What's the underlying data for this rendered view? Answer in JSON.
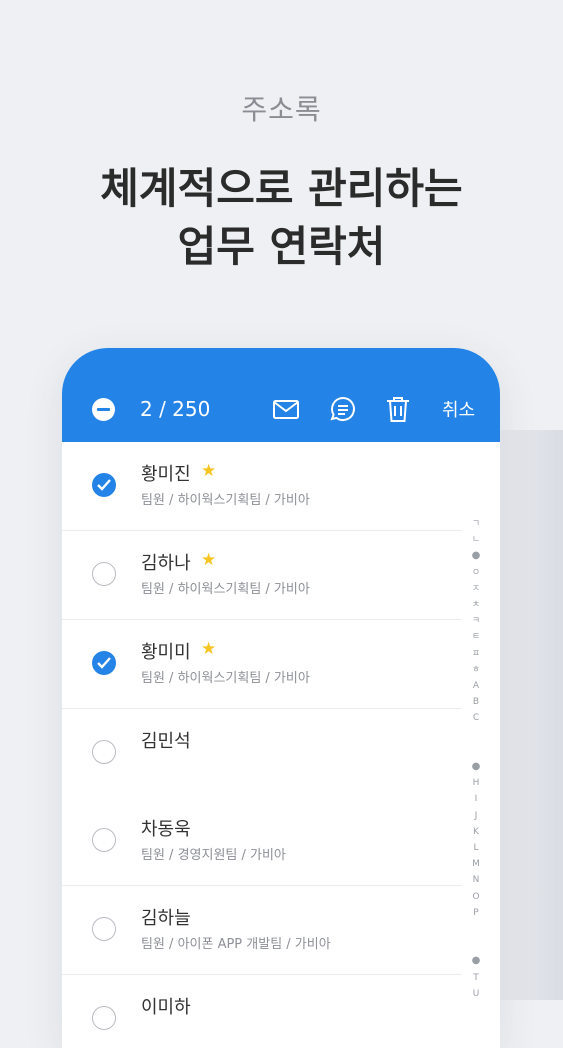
{
  "promo": {
    "subtitle": "주소록",
    "title_line1": "체계적으로 관리하는",
    "title_line2": "업무 연락처"
  },
  "toolbar": {
    "count": "2 / 250",
    "mail_icon": "mail-icon",
    "chat_icon": "chat-icon",
    "trash_icon": "trash-icon",
    "cancel_label": "취소"
  },
  "contacts": [
    {
      "name": "황미진",
      "star": "★",
      "detail": "팀원 / 하이웍스기획팀 / 가비아",
      "checked": true
    },
    {
      "name": "김하나",
      "star": "★",
      "detail": "팀원 / 하이웍스기획팀 / 가비아",
      "checked": false
    },
    {
      "name": "황미미",
      "star": "★",
      "detail": "팀원 / 하이웍스기획팀 / 가비아",
      "checked": true
    },
    {
      "name": "김민석",
      "star": "",
      "detail": "",
      "checked": false
    },
    {
      "name": "차동욱",
      "star": "",
      "detail": "팀원 / 경영지원팀 / 가비아",
      "checked": false
    },
    {
      "name": "김하늘",
      "star": "",
      "detail": "팀원 / 아이폰 APP 개발팀 / 가비아",
      "checked": false
    },
    {
      "name": "이미하",
      "star": "",
      "detail": "",
      "checked": false
    }
  ],
  "index_letters": [
    "ㄱ",
    "ㄴ",
    "●",
    "ㅇ",
    "ㅈ",
    "ㅊ",
    "ㅋ",
    "ㅌ",
    "ㅍ",
    "ㅎ",
    "A",
    "B",
    "C",
    "",
    "",
    "●",
    "H",
    "I",
    "J",
    "K",
    "L",
    "M",
    "N",
    "O",
    "P",
    "",
    "",
    "●",
    "T",
    "U"
  ],
  "colors": {
    "accent": "#2383e6",
    "star": "#f7c521",
    "background": "#eef0f3"
  }
}
